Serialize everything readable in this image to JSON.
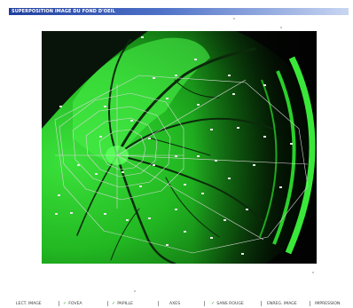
{
  "window": {
    "title": "SUPERPOSITION IMAGE DU FOND D'OEIL"
  },
  "colors": {
    "title_bar_start": "#1f3f9f",
    "title_bar_end": "#c9d6f2",
    "fundus_background": "#0a0f0a",
    "fundus_green": "#2fd12f",
    "overlay": "#d8d8d8",
    "check": "#2aa52a"
  },
  "toolbar": {
    "select_image": {
      "label": "LECT. IMAGE"
    },
    "fovea": {
      "label": "FOVEA",
      "checked": true,
      "icon": "check-icon"
    },
    "papille": {
      "label": "PAPILLE",
      "checked": true,
      "icon": "check-icon"
    },
    "axes": {
      "label": "AXES"
    },
    "sans_rouge": {
      "label": "SANS ROUGE",
      "checked": true,
      "icon": "check-icon"
    },
    "save_image": {
      "label": "ENREG. IMAGE"
    },
    "print": {
      "label": "IMPRESSION"
    }
  }
}
